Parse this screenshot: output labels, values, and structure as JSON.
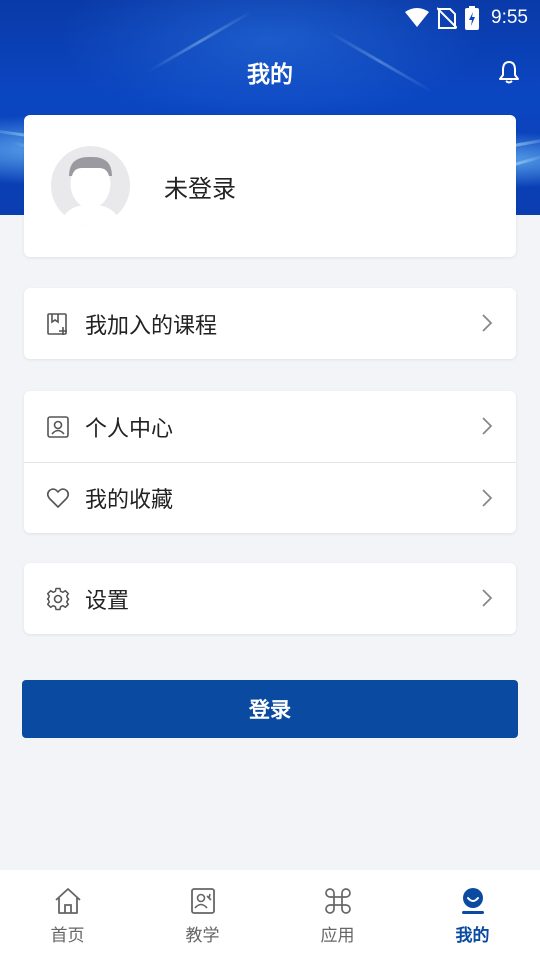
{
  "status_bar": {
    "time": "9:55"
  },
  "header": {
    "title": "我的"
  },
  "profile": {
    "name": "未登录"
  },
  "menu_groups": [
    [
      {
        "label": "我加入的课程",
        "icon": "course-icon"
      }
    ],
    [
      {
        "label": "个人中心",
        "icon": "person-card-icon"
      },
      {
        "label": "我的收藏",
        "icon": "heart-icon"
      }
    ],
    [
      {
        "label": "设置",
        "icon": "gear-icon"
      }
    ]
  ],
  "login_button": {
    "label": "登录"
  },
  "tabs": [
    {
      "label": "首页",
      "icon": "home-icon",
      "active": false
    },
    {
      "label": "教学",
      "icon": "teaching-icon",
      "active": false
    },
    {
      "label": "应用",
      "icon": "apps-icon",
      "active": false
    },
    {
      "label": "我的",
      "icon": "user-icon",
      "active": true
    }
  ],
  "colors": {
    "primary": "#0a4aa0",
    "header_blue": "#0b46c2",
    "background": "#f3f4f8"
  }
}
